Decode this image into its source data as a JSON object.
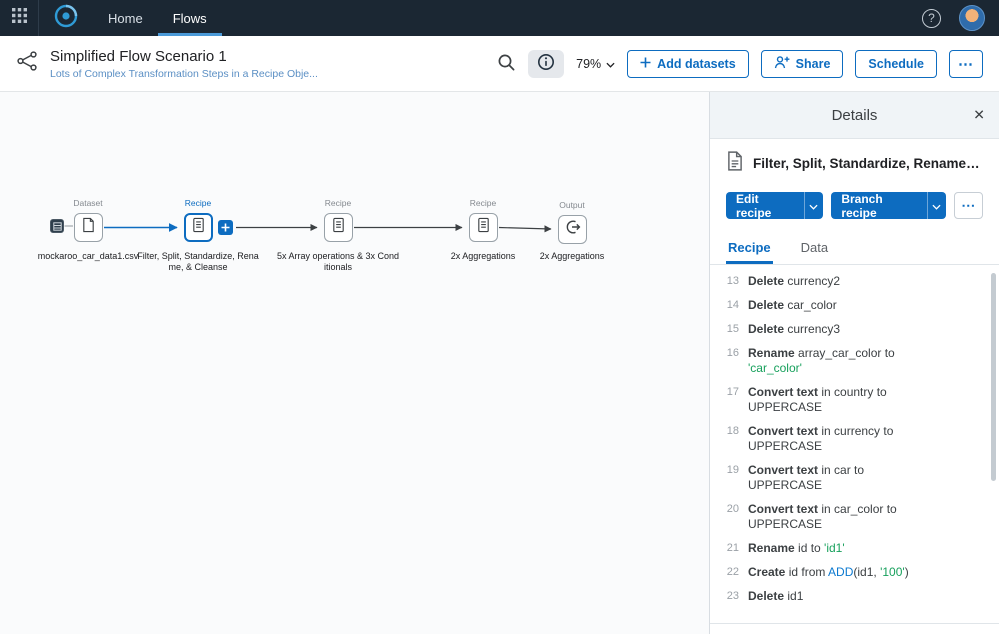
{
  "topbar": {
    "nav": [
      {
        "label": "Home"
      },
      {
        "label": "Flows"
      }
    ]
  },
  "header": {
    "title": "Simplified Flow Scenario 1",
    "subtitle": "Lots of Complex Transformation Steps in a Recipe Obje...",
    "zoom_level": "79%",
    "add_datasets_label": "Add datasets",
    "share_label": "Share",
    "schedule_label": "Schedule",
    "more_label": "⋯"
  },
  "canvas": {
    "nodes": [
      {
        "type": "Dataset",
        "label": "mockaroo_car_data1.csv"
      },
      {
        "type": "Recipe",
        "label": "Filter, Split, Standardize, Rename, & Cleanse",
        "selected": true
      },
      {
        "type": "Recipe",
        "label": "5x Array operations & 3x Conditionals"
      },
      {
        "type": "Recipe",
        "label": "2x Aggregations"
      },
      {
        "type": "Output",
        "label": "2x Aggregations"
      }
    ]
  },
  "details": {
    "panel_title": "Details",
    "close_label": "✕",
    "item_title": "Filter, Split, Standardize, Rename, & Cleanse",
    "edit_recipe_label": "Edit recipe",
    "branch_recipe_label": "Branch recipe",
    "more_label": "⋯",
    "tabs": [
      {
        "label": "Recipe",
        "active": true
      },
      {
        "label": "Data",
        "active": false
      }
    ],
    "steps": [
      {
        "num": "13",
        "parts": [
          {
            "c": "k",
            "t": "Delete"
          },
          {
            "c": "p",
            "t": " currency2"
          }
        ]
      },
      {
        "num": "14",
        "parts": [
          {
            "c": "k",
            "t": "Delete"
          },
          {
            "c": "p",
            "t": " car_color"
          }
        ]
      },
      {
        "num": "15",
        "parts": [
          {
            "c": "k",
            "t": "Delete"
          },
          {
            "c": "p",
            "t": " currency3"
          }
        ]
      },
      {
        "num": "16",
        "parts": [
          {
            "c": "k",
            "t": "Rename"
          },
          {
            "c": "p",
            "t": " array_car_color to "
          },
          {
            "c": "s",
            "t": "'car_color'"
          }
        ]
      },
      {
        "num": "17",
        "parts": [
          {
            "c": "k",
            "t": "Convert text"
          },
          {
            "c": "p",
            "t": " in country to UPPERCASE"
          }
        ]
      },
      {
        "num": "18",
        "parts": [
          {
            "c": "k",
            "t": "Convert text"
          },
          {
            "c": "p",
            "t": " in currency to UPPERCASE"
          }
        ]
      },
      {
        "num": "19",
        "parts": [
          {
            "c": "k",
            "t": "Convert text"
          },
          {
            "c": "p",
            "t": " in car to UPPERCASE"
          }
        ]
      },
      {
        "num": "20",
        "parts": [
          {
            "c": "k",
            "t": "Convert text"
          },
          {
            "c": "p",
            "t": " in car_color to UPPERCASE"
          }
        ]
      },
      {
        "num": "21",
        "parts": [
          {
            "c": "k",
            "t": "Rename"
          },
          {
            "c": "p",
            "t": " id to "
          },
          {
            "c": "s",
            "t": "'id1'"
          }
        ]
      },
      {
        "num": "22",
        "parts": [
          {
            "c": "k",
            "t": "Create"
          },
          {
            "c": "p",
            "t": " id from "
          },
          {
            "c": "f",
            "t": "ADD"
          },
          {
            "c": "p",
            "t": "(id1, "
          },
          {
            "c": "s",
            "t": "'100'"
          },
          {
            "c": "p",
            "t": ")"
          }
        ]
      },
      {
        "num": "23",
        "parts": [
          {
            "c": "k",
            "t": "Delete"
          },
          {
            "c": "p",
            "t": " id1"
          }
        ]
      }
    ]
  },
  "colors": {
    "accent_blue": "#0d6cc0",
    "string_green": "#17a05c",
    "function_blue": "#0b79d0",
    "topbar_bg": "#1b2733",
    "selected_node_border": "#0d6cc0"
  }
}
